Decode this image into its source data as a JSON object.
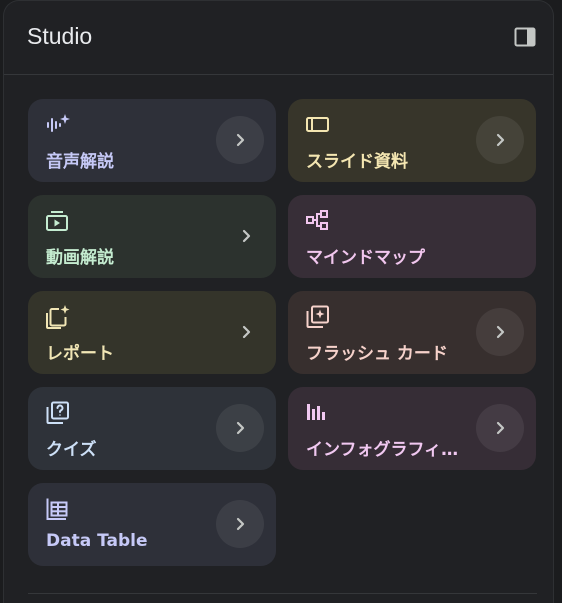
{
  "panel": {
    "title": "Studio",
    "collapse_icon": "side-panel-icon"
  },
  "cards": [
    {
      "id": "audio-overview",
      "label": "音声解説",
      "icon": "audio-sparkle-icon",
      "bg": "#2e3039",
      "fg": "#c6c9f7",
      "arrow": "circle"
    },
    {
      "id": "slides",
      "label": "スライド資料",
      "icon": "slides-icon",
      "bg": "#37352a",
      "fg": "#f4e6b1",
      "arrow": "circle"
    },
    {
      "id": "video-overview",
      "label": "動画解説",
      "icon": "video-icon",
      "bg": "#2c322e",
      "fg": "#c4ecd0",
      "arrow": "plain"
    },
    {
      "id": "mind-map",
      "label": "マインドマップ",
      "icon": "mind-map-icon",
      "bg": "#372e37",
      "fg": "#f1c6ee",
      "arrow": "none"
    },
    {
      "id": "report",
      "label": "レポート",
      "icon": "report-sparkle-icon",
      "bg": "#34342a",
      "fg": "#f1e6b5",
      "arrow": "plain"
    },
    {
      "id": "flashcards",
      "label": "フラッシュ カード",
      "icon": "flashcards-icon",
      "bg": "#372f2e",
      "fg": "#f6d2cb",
      "arrow": "circle"
    },
    {
      "id": "quiz",
      "label": "クイズ",
      "icon": "quiz-icon",
      "bg": "#2e3239",
      "fg": "#cde0f7",
      "arrow": "circle"
    },
    {
      "id": "infographic",
      "label": "インフォグラフィ…",
      "icon": "infographic-icon",
      "bg": "#362d36",
      "fg": "#f1c8f1",
      "arrow": "circle"
    },
    {
      "id": "data-table",
      "label": "Data Table",
      "icon": "table-icon",
      "bg": "#2e3039",
      "fg": "#c6c9f7",
      "arrow": "circle"
    }
  ],
  "colors": {
    "panel_bg": "#202124",
    "title": "#e8eaed",
    "arrow": "#c4c7c5"
  }
}
